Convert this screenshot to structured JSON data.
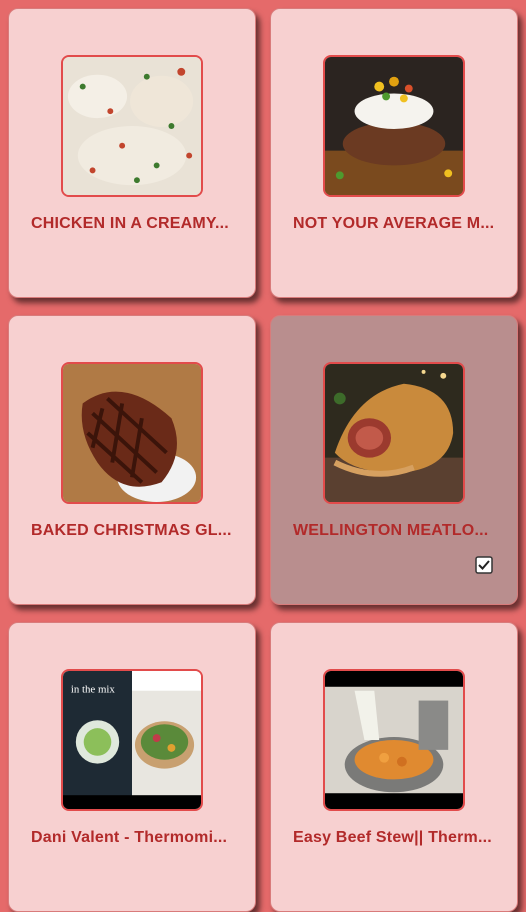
{
  "recipes": [
    {
      "title": "CHICKEN IN A CREAMY...",
      "image_icon": "creamy-chicken-image",
      "selected": false
    },
    {
      "title": "NOT YOUR AVERAGE M...",
      "image_icon": "meatloaf-mash-image",
      "selected": false
    },
    {
      "title": "BAKED CHRISTMAS GL...",
      "image_icon": "glazed-ham-image",
      "selected": false
    },
    {
      "title": "WELLINGTON MEATLO...",
      "image_icon": "beef-wellington-image",
      "selected": true
    },
    {
      "title": "Dani Valent - Thermomi...",
      "image_icon": "cookbook-cover-image",
      "selected": false
    },
    {
      "title": "Easy Beef Stew|| Therm...",
      "image_icon": "beef-stew-video-image",
      "selected": false
    }
  ],
  "colors": {
    "background": "#e56a6a",
    "card": "#f7d0d0",
    "card_selected": "#b98e8e",
    "title_text": "#b22a2a",
    "thumb_border": "#e24b4b"
  },
  "selection_icon": "checkbox-checked-icon"
}
